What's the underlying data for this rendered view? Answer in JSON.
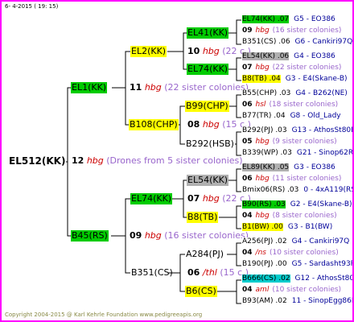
{
  "date": "6-  4-2015 ( 19: 15)",
  "footer": "Copyright 2004-2015 @ Karl Kehrle Foundation    www.pedigreeapis.org",
  "colors": {
    "green": "#00cc00",
    "yellow": "#ffff00",
    "gray": "#b0b0b0",
    "cyan": "#00cccc",
    "frame": "#ff00ff",
    "hbg": "#cc0000"
  },
  "root": {
    "name": "EL512(KK)",
    "num": "12",
    "hbg": "hbg",
    "note": "(Drones from 5 sister colonies)"
  },
  "g1": [
    {
      "name": "EL1(KK)",
      "num": "11",
      "hbg": "hbg",
      "note": "(22 sister colonies)"
    },
    {
      "name": "B45(RS)",
      "num": "09",
      "hbg": "hbg",
      "note": "(16 sister colonies)"
    }
  ],
  "g2": [
    {
      "name": "EL2(KK)",
      "num": "10",
      "hbg": "hbg",
      "note": "(22 c.)"
    },
    {
      "name": "B108(CHP)",
      "num": "08",
      "hbg": "hbg",
      "note": "(15 c.)"
    },
    {
      "name": "EL74(KK)",
      "num": "07",
      "hbg": "hbg",
      "note": "(22 c.)"
    },
    {
      "name": "B351(CS)",
      "num": "06",
      "hbg": "/thl",
      "note": "(15 c.)"
    }
  ],
  "g3": [
    {
      "name": "EL41(KK)"
    },
    {
      "name": "EL74(KK)"
    },
    {
      "name": "B99(CHP)"
    },
    {
      "name": "B292(HSB)"
    },
    {
      "name": "EL54(KK)"
    },
    {
      "name": "B8(TB)"
    },
    {
      "name": "A284(PJ)"
    },
    {
      "name": "B6(CS)"
    }
  ],
  "g4": [
    {
      "top": "EL74(KK) .07",
      "topr": "G5 - EO386",
      "mid_num": "09",
      "mid_hbg": "hbg",
      "mid_note": "(16 sister colonies)",
      "bot": "B351(CS) .06",
      "botr": "G6 - Cankiri97Q"
    },
    {
      "top": "EL54(KK) .06",
      "topr": "G4 - EO386",
      "mid_num": "07",
      "mid_hbg": "hbg",
      "mid_note": "(22 sister colonies)",
      "bot": "B8(TB) .04",
      "botr": "G3 - E4(Skane-B)"
    },
    {
      "top": "B55(CHP) .03",
      "topr": "G4 - B262(NE)",
      "mid_num": "06",
      "mid_hbg": "hsl",
      "mid_note": "(18 sister colonies)",
      "bot": "B77(TR) .04",
      "botr": "G8 - Old_Lady"
    },
    {
      "top": "B292(PJ) .03",
      "topr": "G13 - AthosSt80R",
      "mid_num": "05",
      "mid_hbg": "hbg",
      "mid_note": "(9 sister colonies)",
      "bot": "B339(WP) .03",
      "botr": "G21 - Sinop62R"
    },
    {
      "top": "EL89(KK) .05",
      "topr": "G3 - EO386",
      "mid_num": "06",
      "mid_hbg": "hbg",
      "mid_note": "(11 sister colonies)",
      "bot": "Bmix06(RS) .03",
      "botr": "0 - 4xA119(RS)"
    },
    {
      "top": "B90(RS) .03",
      "topr": "G2 - E4(Skane-B)",
      "mid_num": "04",
      "mid_hbg": "hbg",
      "mid_note": "(8 sister colonies)",
      "bot": "B1(BW) .00",
      "botr": "G3 - B1(BW)"
    },
    {
      "top": "A256(PJ) .02",
      "topr": "G4 - Cankiri97Q",
      "mid_num": "04",
      "mid_hbg": "/ns",
      "mid_note": "(10 sister colonies)",
      "bot": "B190(PJ) .00",
      "botr": "G5 - Sardasht93R"
    },
    {
      "top": "B666(CS) .02",
      "topr": "G12 - AthosSt80R",
      "mid_num": "04",
      "mid_hbg": "aml",
      "mid_note": "(10 sister colonies)",
      "bot": "B93(AM) .02",
      "botr": "11 - SinopEgg86R"
    }
  ]
}
